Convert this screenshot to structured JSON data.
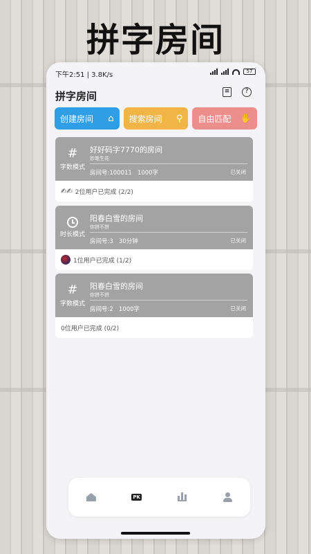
{
  "headline": "拼字房间",
  "statusbar": {
    "time": "下午2:51 | 3.8K/s",
    "battery": "57"
  },
  "header": {
    "title": "拼字房间",
    "icons": [
      "document-icon",
      "help-icon"
    ]
  },
  "actions": [
    {
      "label": "创建房间",
      "icon": "home-plus-icon",
      "color": "#2f9ee6"
    },
    {
      "label": "搜索房间",
      "icon": "search-icon",
      "color": "#f1b447"
    },
    {
      "label": "自由匹配",
      "icon": "hand-icon",
      "color": "#ec8e8c"
    }
  ],
  "rooms": [
    {
      "mode_icon": "#",
      "mode_label": "字数模式",
      "name": "好好码字7770的房间",
      "sub": "妙笔生花",
      "room_no": "房间号:100011",
      "target": "1000字",
      "state": "已关闭",
      "completion": "2位用户已完成 (2/2)"
    },
    {
      "mode_icon": "clock",
      "mode_label": "时长模式",
      "name": "阳春白雪的房间",
      "sub": "你拼不拼",
      "room_no": "房间号:3",
      "target": "30分钟",
      "state": "已关闭",
      "completion": "1位用户已完成 (1/2)"
    },
    {
      "mode_icon": "#",
      "mode_label": "字数模式",
      "name": "阳春白雪的房间",
      "sub": "你拼不拼",
      "room_no": "房间号:2",
      "target": "1000字",
      "state": "已关闭",
      "completion": "0位用户已完成 (0/2)"
    }
  ],
  "tabbar": {
    "items": [
      "home-icon",
      "pk-icon",
      "ranking-icon",
      "profile-icon"
    ],
    "pk_label": "PK"
  }
}
